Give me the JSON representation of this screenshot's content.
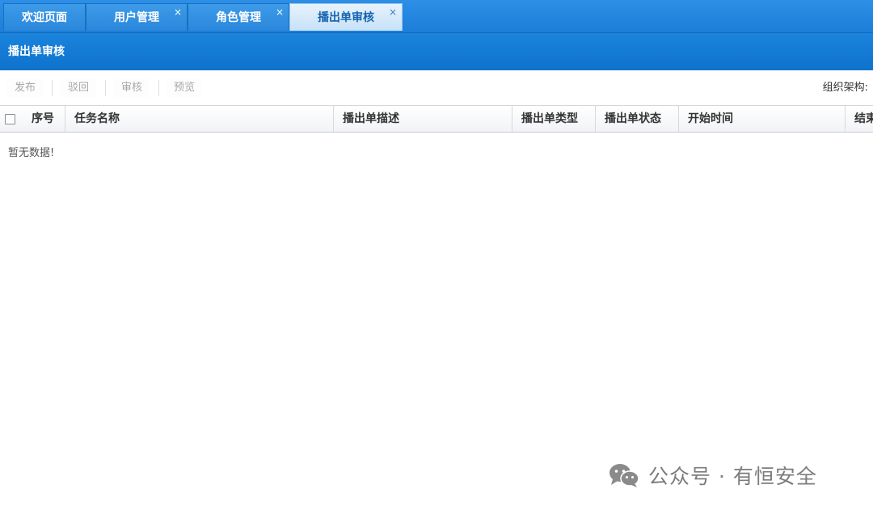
{
  "tabs": [
    {
      "label": "欢迎页面",
      "closable": false,
      "active": false
    },
    {
      "label": "用户管理",
      "closable": true,
      "active": false
    },
    {
      "label": "角色管理",
      "closable": true,
      "active": false
    },
    {
      "label": "播出单审核",
      "closable": true,
      "active": true
    }
  ],
  "close_glyph": "×",
  "panel": {
    "title": "播出单审核"
  },
  "toolbar": {
    "buttons": [
      "发布",
      "驳回",
      "审核",
      "预览"
    ],
    "org_label": "组织架构:"
  },
  "grid": {
    "columns": [
      "序号",
      "任务名称",
      "播出单描述",
      "播出单类型",
      "播出单状态",
      "开始时间",
      "结束"
    ],
    "empty_text": "暂无数据!"
  },
  "watermark": {
    "text": "公众号 · 有恒安全",
    "icon": "wechat-logo-icon"
  },
  "colors": {
    "tab_bar": "#1c7ed8",
    "header_bar": "#0f72cc",
    "active_tab_text": "#1563b0"
  }
}
